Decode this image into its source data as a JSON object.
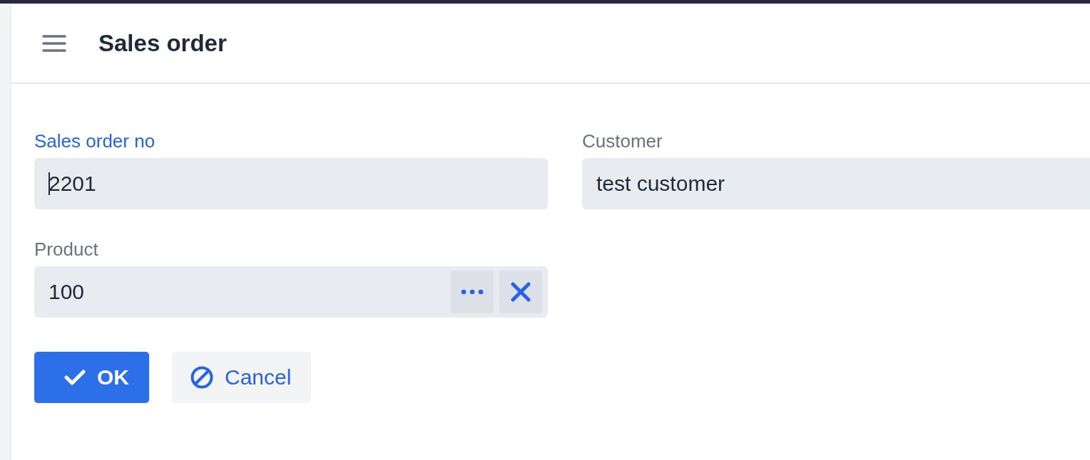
{
  "header": {
    "title": "Sales order"
  },
  "fields": [
    {
      "label": "Sales order no",
      "value": "2201",
      "focused": true,
      "kind": "text"
    },
    {
      "label": "Customer",
      "value": "test customer",
      "focused": false,
      "kind": "text"
    },
    {
      "label": "Product",
      "value": "100",
      "focused": false,
      "kind": "lookup"
    }
  ],
  "buttons": [
    {
      "label": "OK",
      "kind": "primary"
    },
    {
      "label": "Cancel",
      "kind": "secondary"
    }
  ]
}
